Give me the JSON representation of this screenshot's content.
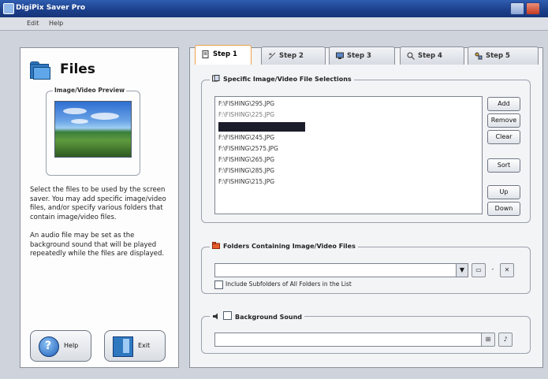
{
  "window": {
    "title": "DigiPix Saver Pro"
  },
  "menu": {
    "items": [
      "Edit",
      "Help"
    ]
  },
  "left": {
    "heading": "Files",
    "preview_label": "Image/Video Preview",
    "desc1": "Select the files to be used by the screen saver. You may add specific image/video files, and/or specify various folders that contain image/video files.",
    "desc2": "An audio file may be set as the background sound that will be played repeatedly while the files are displayed.",
    "help_label": "Help",
    "exit_label": "Exit"
  },
  "tabs": [
    {
      "label": "Step 1",
      "icon": "page-icon"
    },
    {
      "label": "Step 2",
      "icon": "effects-icon"
    },
    {
      "label": "Step 3",
      "icon": "monitor-icon"
    },
    {
      "label": "Step 4",
      "icon": "search-icon"
    },
    {
      "label": "Step 5",
      "icon": "tools-icon"
    }
  ],
  "files_group": {
    "label": "Specific Image/Video File Selections",
    "items": [
      "F:\\FISHING\\295.JPG",
      "F:\\FISHING\\225.JPG",
      "",
      "F:\\FISHING\\245.JPG",
      "F:\\FISHING\\2575.JPG",
      "F:\\FISHING\\265.JPG",
      "F:\\FISHING\\285.JPG",
      "F:\\FISHING\\215.JPG"
    ],
    "buttons": {
      "add": "Add",
      "remove": "Remove",
      "clear": "Clear",
      "sort": "Sort",
      "up": "Up",
      "down": "Down"
    }
  },
  "folders_group": {
    "label": "Folders Containing Image/Video Files",
    "combo_value": "",
    "include_subfolders_label": "Include Subfolders of All Folders in the List"
  },
  "sound_group": {
    "label": "Background Sound",
    "value": ""
  },
  "colors": {
    "titlebar": "#1c3f8a",
    "active_tab_border": "#f0a14a",
    "selection": "#1c1d2a"
  }
}
